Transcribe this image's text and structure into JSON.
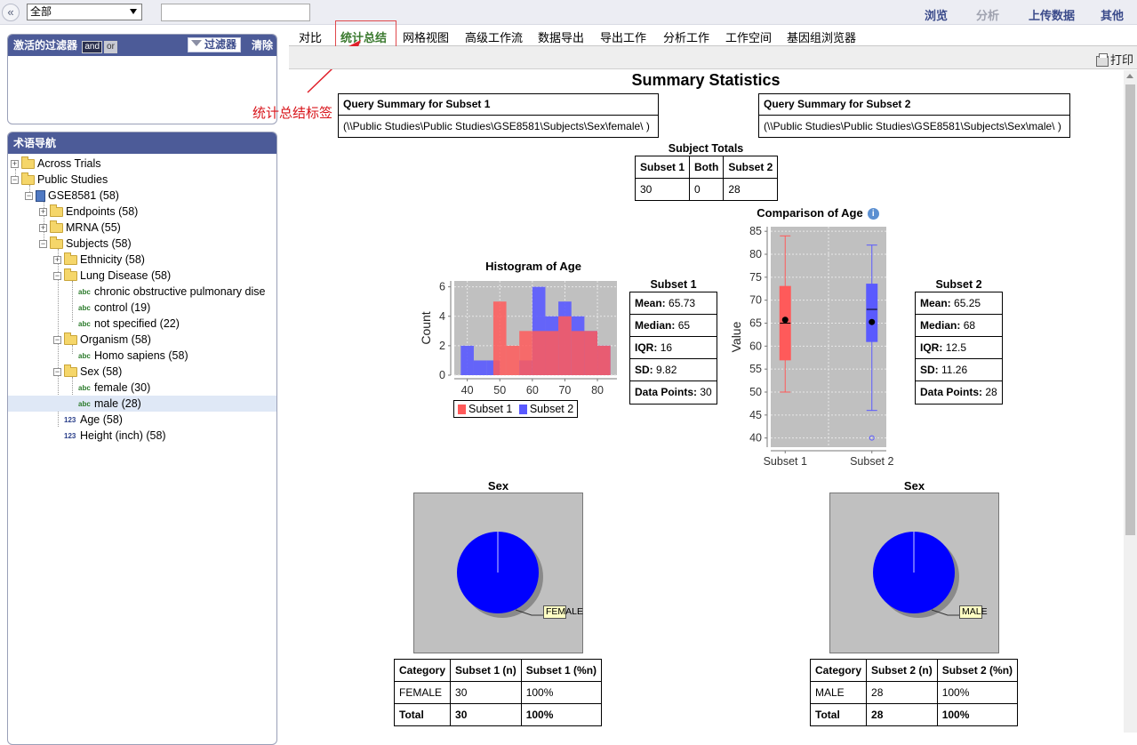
{
  "topbar": {
    "collapse_glyph": "«",
    "scope_select": "全部",
    "search_value": "",
    "nav": [
      "浏览",
      "分析",
      "上传数据",
      "其他"
    ]
  },
  "filters_panel": {
    "title": "激活的过滤器",
    "and_label": "and",
    "or_label": "or",
    "filter_button": "过滤器",
    "clear_link": "清除"
  },
  "tree_panel": {
    "title": "术语导航",
    "nodes": [
      {
        "label": "Across Trials",
        "count": ""
      },
      {
        "label": "Public Studies",
        "count": ""
      },
      {
        "label": "GSE8581",
        "count": "(58)"
      },
      {
        "label": "Endpoints",
        "count": "(58)"
      },
      {
        "label": "MRNA",
        "count": "(55)"
      },
      {
        "label": "Subjects",
        "count": "(58)"
      },
      {
        "label": "Ethnicity",
        "count": "(58)"
      },
      {
        "label": "Lung Disease",
        "count": "(58)"
      },
      {
        "label": "chronic obstructive pulmonary dise",
        "count": ""
      },
      {
        "label": "control",
        "count": "(19)"
      },
      {
        "label": "not specified",
        "count": "(22)"
      },
      {
        "label": "Organism",
        "count": "(58)"
      },
      {
        "label": "Homo sapiens",
        "count": "(58)"
      },
      {
        "label": "Sex",
        "count": "(58)"
      },
      {
        "label": "female",
        "count": "(30)"
      },
      {
        "label": "male",
        "count": "(28)"
      },
      {
        "label": "Age",
        "count": "(58)"
      },
      {
        "label": "Height (inch)",
        "count": "(58)"
      }
    ],
    "type_tags": {
      "text": "abc",
      "numeric": "123"
    }
  },
  "tabs": [
    "对比",
    "统计总结",
    "网格视图",
    "高级工作流",
    "数据导出",
    "导出工作",
    "分析工作",
    "工作空间",
    "基因组浏览器"
  ],
  "active_tab": "统计总结",
  "annotation": "统计总结标签",
  "print_label": "打印",
  "summary": {
    "title": "Summary Statistics",
    "query1": {
      "title": "Query Summary for Subset 1",
      "path": "(\\\\Public Studies\\Public Studies\\GSE8581\\Subjects\\Sex\\female\\ )"
    },
    "query2": {
      "title": "Query Summary for Subset 2",
      "path": "(\\\\Public Studies\\Public Studies\\GSE8581\\Subjects\\Sex\\male\\ )"
    },
    "totals": {
      "title": "Subject Totals",
      "headers": [
        "Subset 1",
        "Both",
        "Subset 2"
      ],
      "values": [
        "30",
        "0",
        "28"
      ]
    },
    "stats1": {
      "title": "Subset 1",
      "rows": [
        {
          "k": "Mean:",
          "v": "65.73"
        },
        {
          "k": "Median:",
          "v": "65"
        },
        {
          "k": "IQR:",
          "v": "16"
        },
        {
          "k": "SD:",
          "v": "9.82"
        },
        {
          "k": "Data Points:",
          "v": "30"
        }
      ]
    },
    "stats2": {
      "title": "Subset 2",
      "rows": [
        {
          "k": "Mean:",
          "v": "65.25"
        },
        {
          "k": "Median:",
          "v": "68"
        },
        {
          "k": "IQR:",
          "v": "12.5"
        },
        {
          "k": "SD:",
          "v": "11.26"
        },
        {
          "k": "Data Points:",
          "v": "28"
        }
      ]
    },
    "sex1_table": {
      "headers": [
        "Category",
        "Subset 1 (n)",
        "Subset 1 (%n)"
      ],
      "rows": [
        [
          "FEMALE",
          "30",
          "100%"
        ],
        [
          "Total",
          "30",
          "100%"
        ]
      ]
    },
    "sex2_table": {
      "headers": [
        "Category",
        "Subset 2 (n)",
        "Subset 2 (%n)"
      ],
      "rows": [
        [
          "MALE",
          "28",
          "100%"
        ],
        [
          "Total",
          "28",
          "100%"
        ]
      ]
    }
  },
  "colors": {
    "subset1": "#ff5a5a",
    "subset2": "#5a5aff",
    "plot_bg": "#c0c0c0",
    "pie": "#0000ff",
    "header": "#4c5b98"
  },
  "chart_data": [
    {
      "type": "bar",
      "title": "Histogram of Age",
      "xlabel": "",
      "ylabel": "Count",
      "xlim": [
        36,
        86
      ],
      "ylim": [
        0,
        6.4
      ],
      "xticks": [
        40,
        50,
        60,
        70,
        80
      ],
      "yticks": [
        0,
        2,
        4,
        6
      ],
      "bin_width": 4,
      "series": [
        {
          "name": "Subset 1",
          "bins": [
            [
              48,
              52,
              5
            ],
            [
              52,
              56,
              2
            ],
            [
              56,
              60,
              3
            ],
            [
              60,
              64,
              3
            ],
            [
              64,
              68,
              3
            ],
            [
              68,
              72,
              4
            ],
            [
              72,
              76,
              3
            ],
            [
              76,
              80,
              3
            ],
            [
              80,
              84,
              2
            ]
          ]
        },
        {
          "name": "Subset 2",
          "bins": [
            [
              38,
              42,
              2
            ],
            [
              42,
              46,
              1
            ],
            [
              46,
              50,
              1
            ],
            [
              56,
              60,
              1
            ],
            [
              60,
              64,
              6
            ],
            [
              64,
              68,
              4
            ],
            [
              68,
              72,
              5
            ],
            [
              72,
              76,
              4
            ],
            [
              76,
              80,
              3
            ],
            [
              80,
              84,
              2
            ]
          ]
        }
      ],
      "legend": "bottom"
    },
    {
      "type": "box",
      "title": "Comparison of Age",
      "ylabel": "Value",
      "categories": [
        "Subset 1",
        "Subset 2"
      ],
      "ylim": [
        38,
        86
      ],
      "yticks": [
        40,
        45,
        50,
        55,
        60,
        65,
        70,
        75,
        80,
        85
      ],
      "boxes": [
        {
          "name": "Subset 1",
          "whisker_low": 50,
          "q1": 57,
          "median": 65,
          "q3": 73,
          "whisker_high": 84,
          "mean": 65.73,
          "outliers": []
        },
        {
          "name": "Subset 2",
          "whisker_low": 46,
          "q1": 61,
          "median": 68,
          "q3": 73.5,
          "whisker_high": 82,
          "mean": 65.25,
          "outliers": [
            40
          ]
        }
      ]
    },
    {
      "type": "pie",
      "title": "Sex",
      "slices": [
        {
          "label": "FEMALE",
          "value": 30
        }
      ]
    },
    {
      "type": "pie",
      "title": "Sex",
      "slices": [
        {
          "label": "MALE",
          "value": 28
        }
      ]
    }
  ]
}
